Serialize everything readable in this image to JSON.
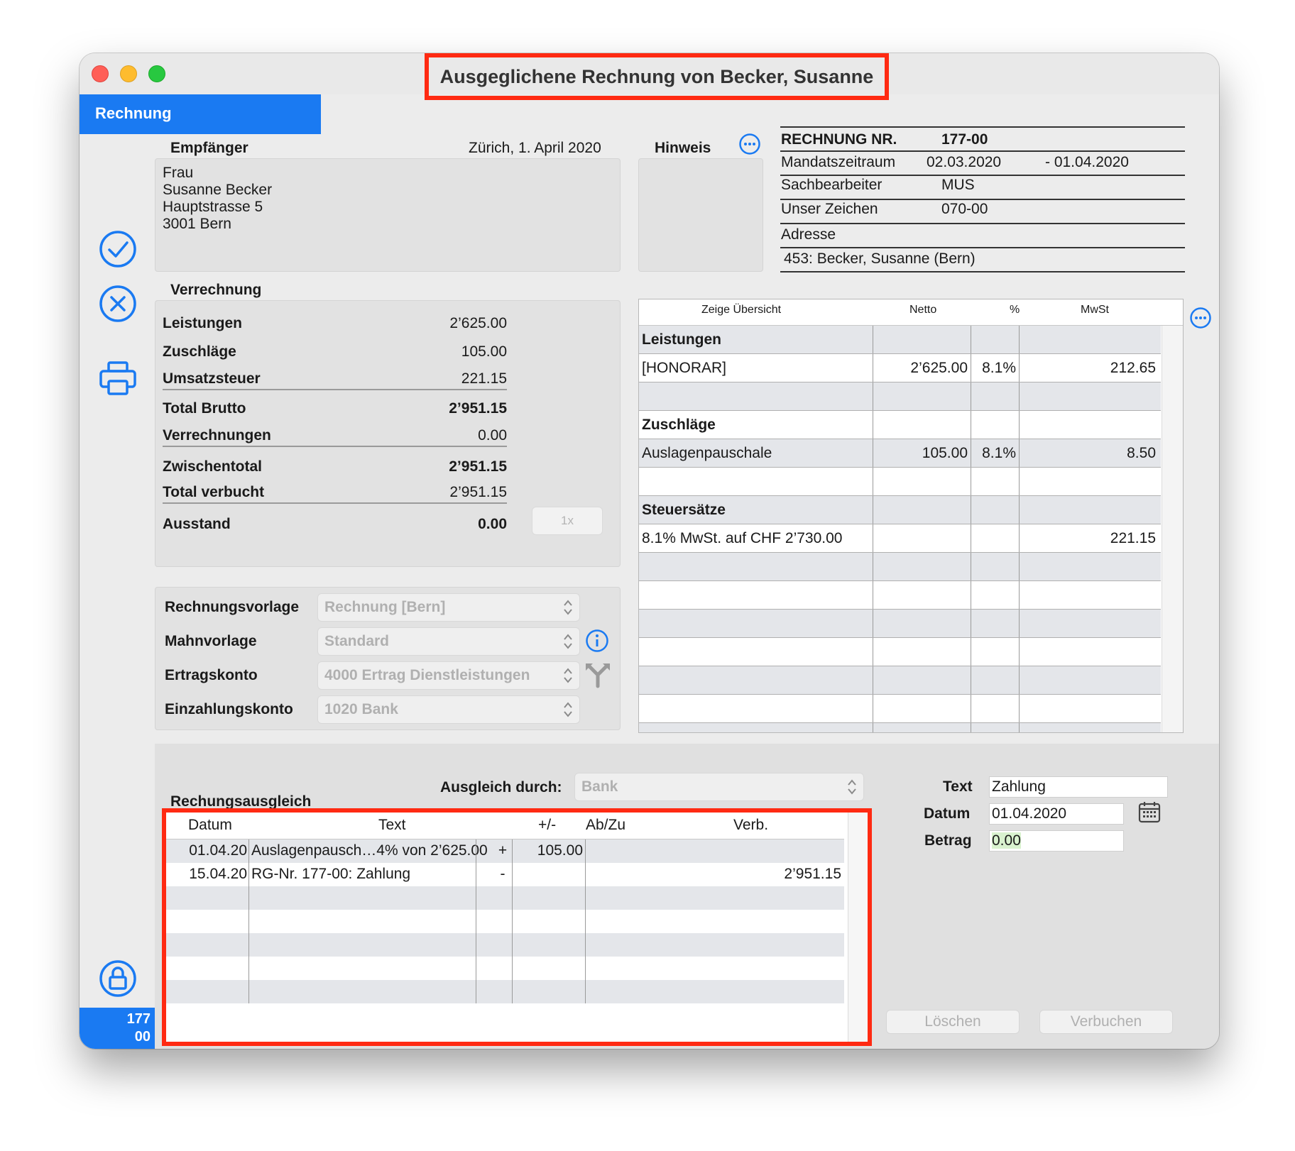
{
  "window": {
    "title": "Ausgeglichene Rechnung von Becker, Susanne"
  },
  "tab": {
    "label": "Rechnung"
  },
  "badge": {
    "line1": "177",
    "line2": "00"
  },
  "recipient": {
    "heading": "Empfänger",
    "date_line": "Zürich, 1. April 2020",
    "lines": [
      "Frau",
      "Susanne Becker",
      "Hauptstrasse 5",
      "3001 Bern"
    ]
  },
  "hinweis": {
    "label": "Hinweis"
  },
  "info": {
    "invoice_label": "RECHNUNG NR.",
    "invoice_no": "177-00",
    "mandate_label": "Mandatszeitraum",
    "mandate_from": "02.03.2020",
    "mandate_to": "- 01.04.2020",
    "clerk_label": "Sachbearbeiter",
    "clerk": "MUS",
    "ref_label": "Unser Zeichen",
    "ref": "070-00",
    "address_label": "Adresse",
    "address": "453: Becker, Susanne (Bern)"
  },
  "verrechnung": {
    "heading": "Verrechnung",
    "rows": [
      {
        "label": "Leistungen",
        "value": "2’625.00"
      },
      {
        "label": "Zuschläge",
        "value": "105.00"
      },
      {
        "label": "Umsatzsteuer",
        "value": "221.15"
      },
      {
        "label": "Total Brutto",
        "value": "2’951.15"
      },
      {
        "label": "Verrechnungen",
        "value": "0.00"
      },
      {
        "label": "Zwischentotal",
        "value": "2’951.15"
      },
      {
        "label": "Total verbucht",
        "value": "2’951.15"
      },
      {
        "label": "Ausstand",
        "value": "0.00"
      }
    ],
    "button_1x": "1x"
  },
  "settings": {
    "rows": [
      {
        "label": "Rechnungsvorlage",
        "value": "Rechnung [Bern]"
      },
      {
        "label": "Mahnvorlage",
        "value": "Standard"
      },
      {
        "label": "Ertragskonto",
        "value": "4000 Ertrag Dienstleistungen"
      },
      {
        "label": "Einzahlungskonto",
        "value": "1020 Bank"
      }
    ]
  },
  "overview": {
    "headers": [
      "Zeige Übersicht",
      "Netto",
      "%",
      "MwSt"
    ],
    "rows": [
      {
        "c0": "Leistungen",
        "c1": "",
        "c2": "",
        "c3": "",
        "bold": true
      },
      {
        "c0": "[HONORAR]",
        "c1": "2’625.00",
        "c2": "8.1%",
        "c3": "212.65"
      },
      {
        "c0": "",
        "c1": "",
        "c2": "",
        "c3": ""
      },
      {
        "c0": "Zuschläge",
        "c1": "",
        "c2": "",
        "c3": "",
        "bold": true
      },
      {
        "c0": "Auslagenpauschale",
        "c1": "105.00",
        "c2": "8.1%",
        "c3": "8.50"
      },
      {
        "c0": "",
        "c1": "",
        "c2": "",
        "c3": ""
      },
      {
        "c0": "Steuersätze",
        "c1": "",
        "c2": "",
        "c3": "",
        "bold": true
      },
      {
        "c0": "8.1% MwSt. auf CHF 2’730.00",
        "c1": "",
        "c2": "",
        "c3": "221.15"
      },
      {
        "c0": "",
        "c1": "",
        "c2": "",
        "c3": ""
      },
      {
        "c0": "",
        "c1": "",
        "c2": "",
        "c3": ""
      },
      {
        "c0": "",
        "c1": "",
        "c2": "",
        "c3": ""
      },
      {
        "c0": "",
        "c1": "",
        "c2": "",
        "c3": ""
      },
      {
        "c0": "",
        "c1": "",
        "c2": "",
        "c3": ""
      },
      {
        "c0": "",
        "c1": "",
        "c2": "",
        "c3": ""
      },
      {
        "c0": "",
        "c1": "",
        "c2": "",
        "c3": ""
      }
    ]
  },
  "ausgleich": {
    "heading": "Rechungsausgleich",
    "via_label": "Ausgleich durch:",
    "via_value": "Bank",
    "headers": [
      "Datum",
      "Text",
      "+/-",
      "Ab/Zu",
      "Verb."
    ],
    "rows": [
      {
        "date": "01.04.20",
        "text": "Auslagenpausch…4% von 2’625.00",
        "sign": "+",
        "abzu": "105.00",
        "verb": ""
      },
      {
        "date": "15.04.20",
        "text": "RG-Nr. 177-00: Zahlung",
        "sign": "-",
        "abzu": "",
        "verb": "2’951.15"
      },
      {
        "date": "",
        "text": "",
        "sign": "",
        "abzu": "",
        "verb": ""
      },
      {
        "date": "",
        "text": "",
        "sign": "",
        "abzu": "",
        "verb": ""
      },
      {
        "date": "",
        "text": "",
        "sign": "",
        "abzu": "",
        "verb": ""
      },
      {
        "date": "",
        "text": "",
        "sign": "",
        "abzu": "",
        "verb": ""
      },
      {
        "date": "",
        "text": "",
        "sign": "",
        "abzu": "",
        "verb": ""
      }
    ],
    "text_label": "Text",
    "text_value": "Zahlung",
    "date_label": "Datum",
    "date_value": "01.04.2020",
    "amount_label": "Betrag",
    "amount_value": "0.00",
    "delete_label": "Löschen",
    "book_label": "Verbuchen"
  },
  "colors": {
    "accent": "#1a7af2",
    "highlight": "#ff2a12"
  }
}
